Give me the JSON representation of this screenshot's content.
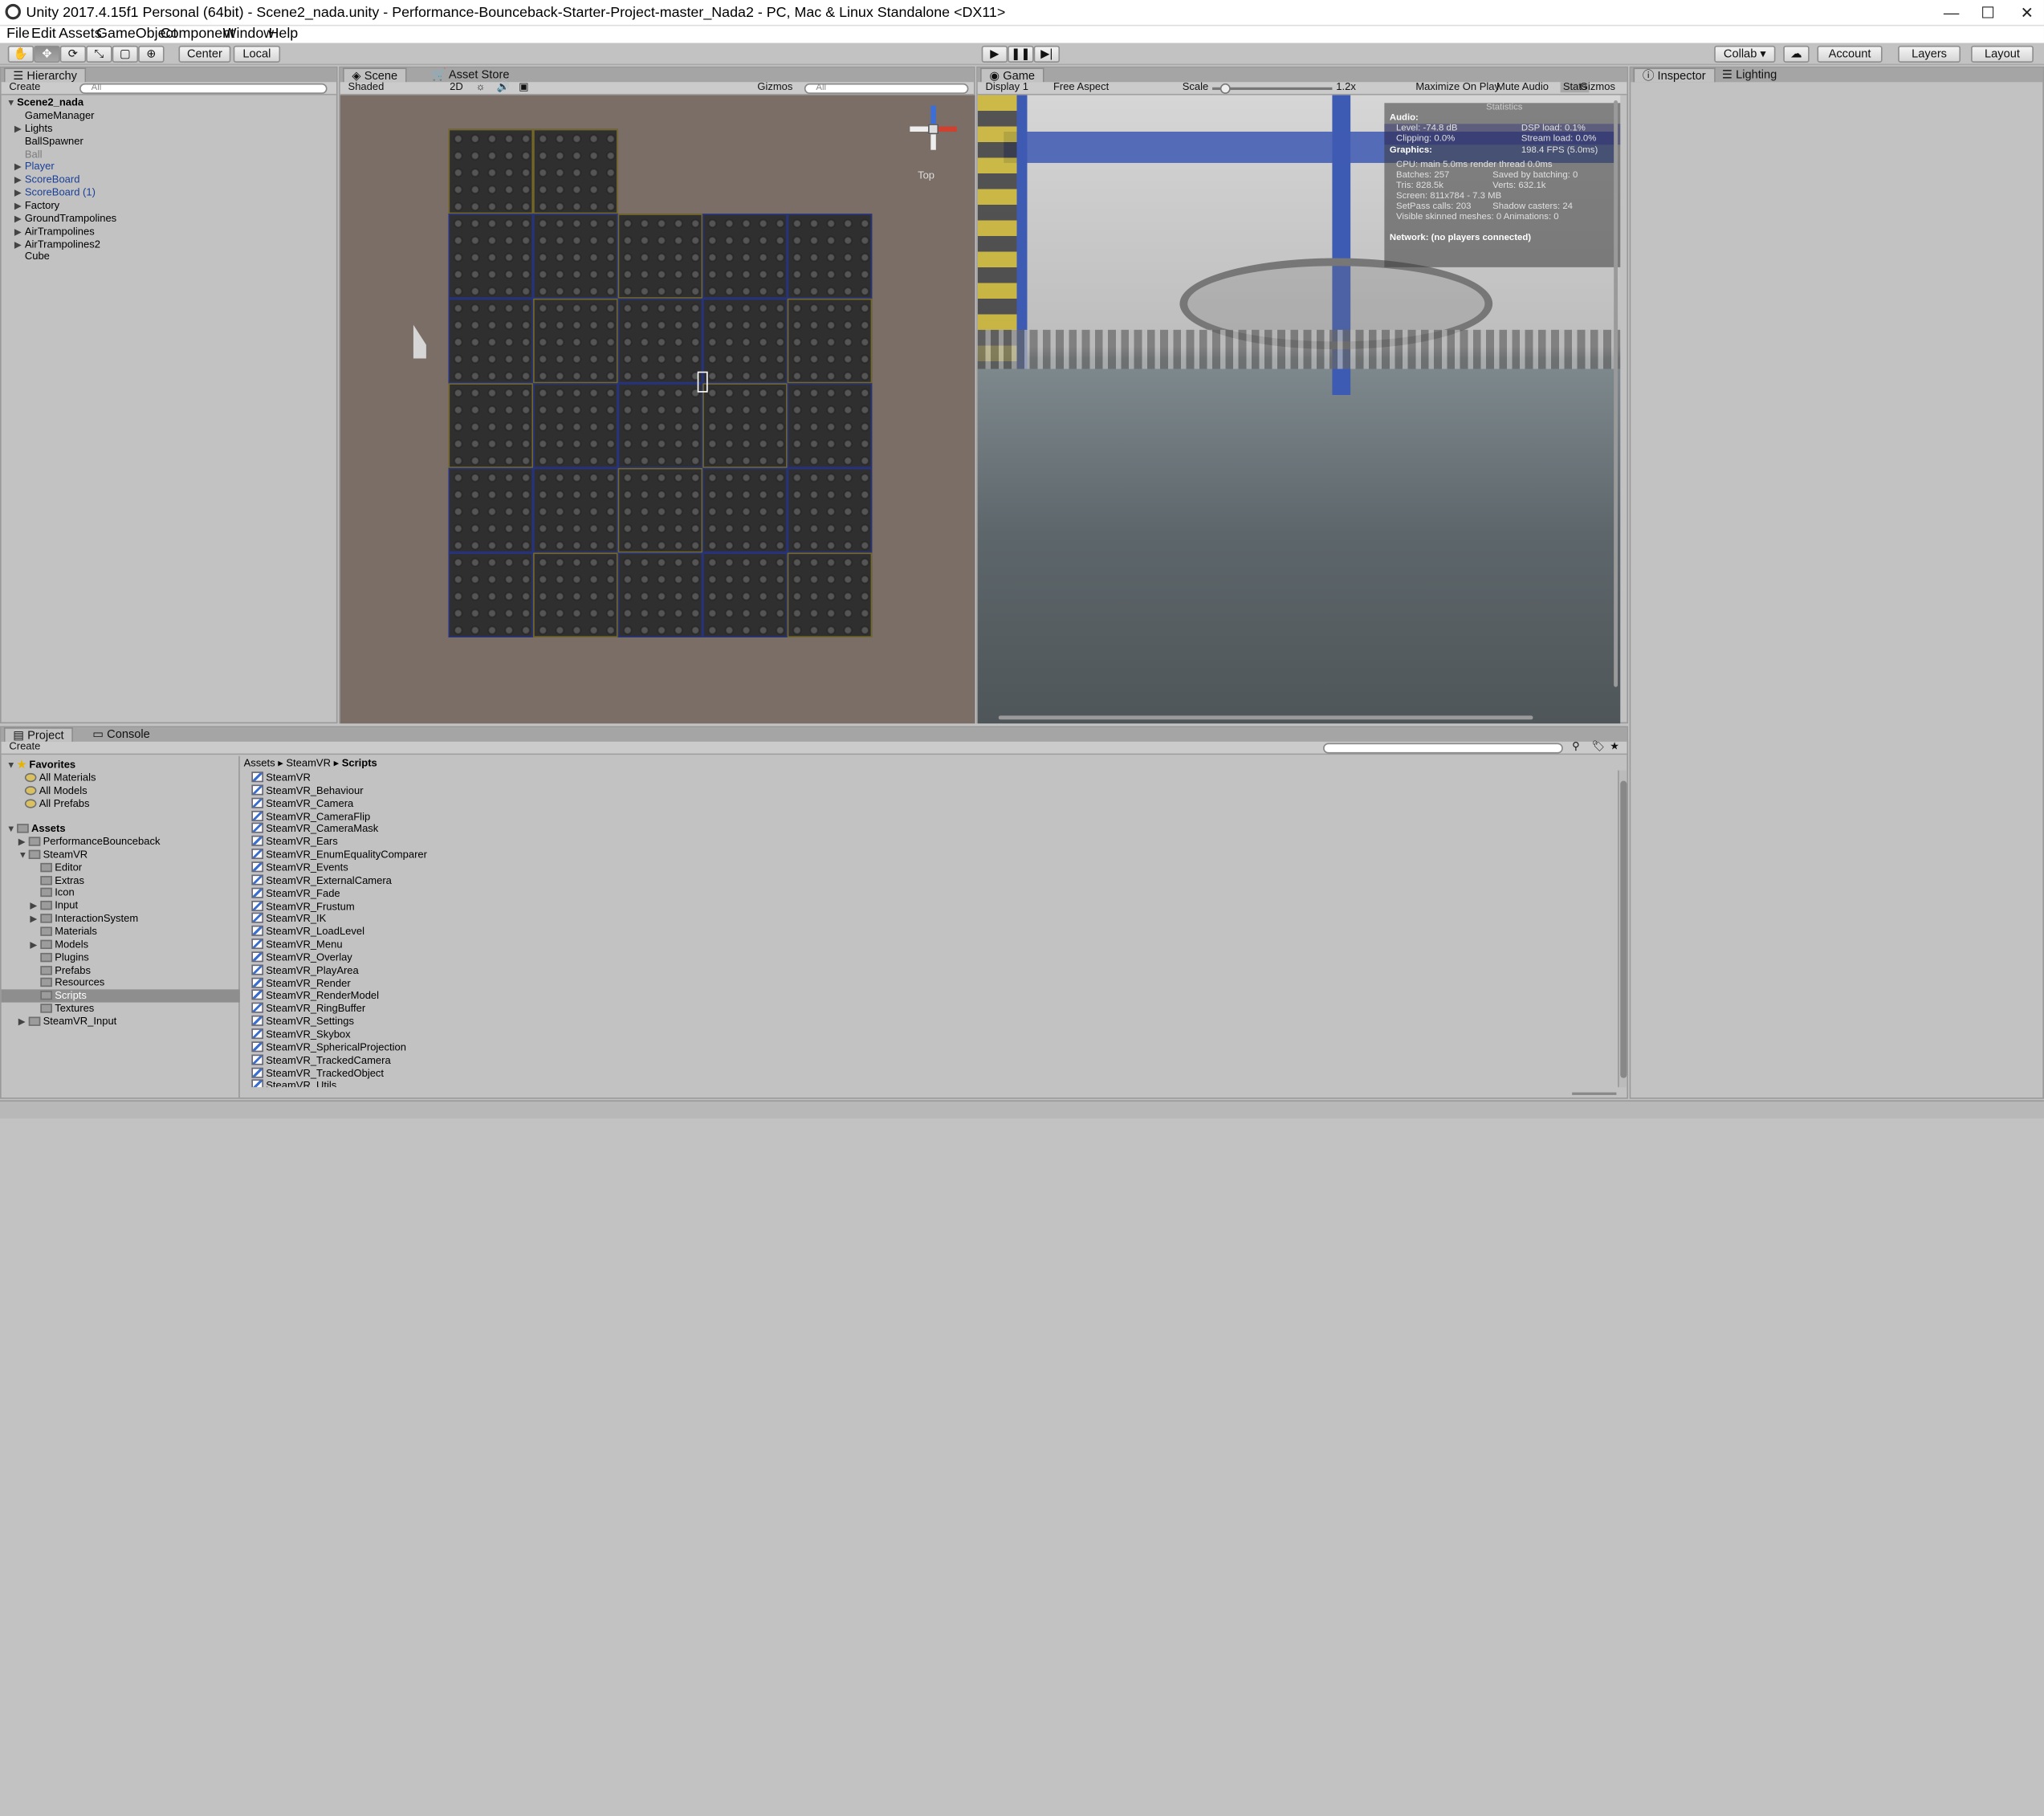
{
  "window": {
    "title": "Unity 2017.4.15f1 Personal (64bit) - Scene2_nada.unity - Performance-Bounceback-Starter-Project-master_Nada2 - PC, Mac & Linux Standalone <DX11>"
  },
  "menu": [
    "File",
    "Edit",
    "Assets",
    "GameObject",
    "Component",
    "Window",
    "Help"
  ],
  "toolbar": {
    "center": "Center",
    "local": "Local",
    "collab": "Collab ▾",
    "account": "Account",
    "layers": "Layers",
    "layout": "Layout"
  },
  "hierarchy": {
    "tab": "Hierarchy",
    "create": "Create",
    "search": "All",
    "scene": "Scene2_nada",
    "items": [
      {
        "label": "GameManager",
        "indent": 1,
        "arrow": false,
        "style": "normal"
      },
      {
        "label": "Lights",
        "indent": 1,
        "arrow": true,
        "style": "normal"
      },
      {
        "label": "BallSpawner",
        "indent": 1,
        "arrow": false,
        "style": "normal"
      },
      {
        "label": "Ball",
        "indent": 1,
        "arrow": false,
        "style": "gray"
      },
      {
        "label": "Player",
        "indent": 1,
        "arrow": true,
        "style": "blue"
      },
      {
        "label": "ScoreBoard",
        "indent": 1,
        "arrow": true,
        "style": "blue"
      },
      {
        "label": "ScoreBoard (1)",
        "indent": 1,
        "arrow": true,
        "style": "blue"
      },
      {
        "label": "Factory",
        "indent": 1,
        "arrow": true,
        "style": "normal"
      },
      {
        "label": "GroundTrampolines",
        "indent": 1,
        "arrow": true,
        "style": "normal"
      },
      {
        "label": "AirTrampolines",
        "indent": 1,
        "arrow": true,
        "style": "normal"
      },
      {
        "label": "AirTrampolines2",
        "indent": 1,
        "arrow": true,
        "style": "normal"
      },
      {
        "label": "Cube",
        "indent": 1,
        "arrow": false,
        "style": "normal"
      }
    ]
  },
  "scene": {
    "tab": "Scene",
    "asset_store": "Asset Store",
    "shading": "Shaded",
    "mode_2d": "2D",
    "gizmos": "Gizmos",
    "search": "All",
    "view_label": "Top"
  },
  "game": {
    "tab": "Game",
    "display": "Display 1",
    "aspect": "Free Aspect",
    "scale_label": "Scale",
    "scale_value": "1.2x",
    "maximize": "Maximize On Play",
    "mute": "Mute Audio",
    "stats_btn": "Stats",
    "gizmos": "Gizmos"
  },
  "stats": {
    "title": "Statistics",
    "audio_hd": "Audio:",
    "level": "Level: -74.8 dB",
    "dsp": "DSP load: 0.1%",
    "clipping": "Clipping: 0.0%",
    "stream": "Stream load: 0.0%",
    "graphics_hd": "Graphics:",
    "fps": "198.4 FPS (5.0ms)",
    "cpu": "CPU: main 5.0ms  render thread 0.0ms",
    "batches": "Batches: 257",
    "saved": "Saved by batching: 0",
    "tris": "Tris: 828.5k",
    "verts": "Verts: 632.1k",
    "screen": "Screen: 811x784 - 7.3 MB",
    "setpass": "SetPass calls: 203",
    "shadow": "Shadow casters: 24",
    "skinned": "Visible skinned meshes: 0  Animations: 0",
    "network": "Network: (no players connected)"
  },
  "inspector": {
    "tab": "Inspector",
    "lighting": "Lighting"
  },
  "project": {
    "tab": "Project",
    "console": "Console",
    "create": "Create",
    "favorites": "Favorites",
    "fav_items": [
      "All Materials",
      "All Models",
      "All Prefabs"
    ],
    "assets": "Assets",
    "tree": [
      {
        "label": "PerformanceBounceback",
        "indent": 1,
        "arrow": "▶",
        "sel": false
      },
      {
        "label": "SteamVR",
        "indent": 1,
        "arrow": "▼",
        "sel": false
      },
      {
        "label": "Editor",
        "indent": 2,
        "arrow": "",
        "sel": false
      },
      {
        "label": "Extras",
        "indent": 2,
        "arrow": "",
        "sel": false
      },
      {
        "label": "Icon",
        "indent": 2,
        "arrow": "",
        "sel": false
      },
      {
        "label": "Input",
        "indent": 2,
        "arrow": "▶",
        "sel": false
      },
      {
        "label": "InteractionSystem",
        "indent": 2,
        "arrow": "▶",
        "sel": false
      },
      {
        "label": "Materials",
        "indent": 2,
        "arrow": "",
        "sel": false
      },
      {
        "label": "Models",
        "indent": 2,
        "arrow": "▶",
        "sel": false
      },
      {
        "label": "Plugins",
        "indent": 2,
        "arrow": "",
        "sel": false
      },
      {
        "label": "Prefabs",
        "indent": 2,
        "arrow": "",
        "sel": false
      },
      {
        "label": "Resources",
        "indent": 2,
        "arrow": "",
        "sel": false
      },
      {
        "label": "Scripts",
        "indent": 2,
        "arrow": "",
        "sel": true
      },
      {
        "label": "Textures",
        "indent": 2,
        "arrow": "",
        "sel": false
      },
      {
        "label": "SteamVR_Input",
        "indent": 1,
        "arrow": "▶",
        "sel": false
      }
    ],
    "breadcrumb": [
      "Assets",
      "SteamVR",
      "Scripts"
    ],
    "files": [
      "SteamVR",
      "SteamVR_Behaviour",
      "SteamVR_Camera",
      "SteamVR_CameraFlip",
      "SteamVR_CameraMask",
      "SteamVR_Ears",
      "SteamVR_EnumEqualityComparer",
      "SteamVR_Events",
      "SteamVR_ExternalCamera",
      "SteamVR_Fade",
      "SteamVR_Frustum",
      "SteamVR_IK",
      "SteamVR_LoadLevel",
      "SteamVR_Menu",
      "SteamVR_Overlay",
      "SteamVR_PlayArea",
      "SteamVR_Render",
      "SteamVR_RenderModel",
      "SteamVR_RingBuffer",
      "SteamVR_Settings",
      "SteamVR_Skybox",
      "SteamVR_SphericalProjection",
      "SteamVR_TrackedCamera",
      "SteamVR_TrackedObject",
      "SteamVR_Utils"
    ]
  }
}
